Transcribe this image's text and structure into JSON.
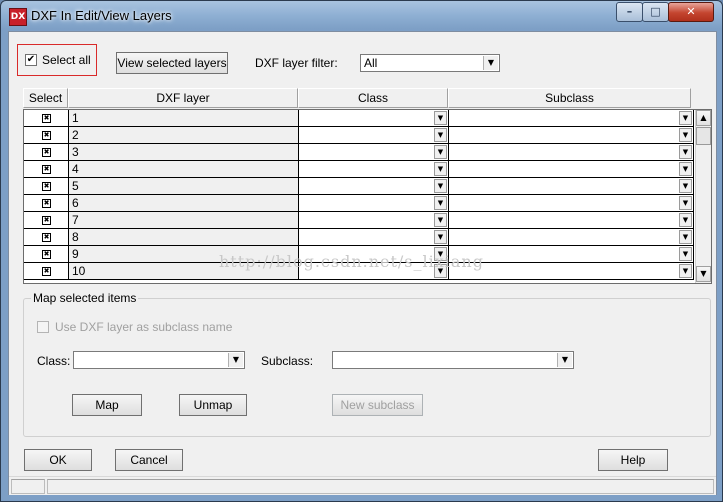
{
  "window": {
    "title": "DXF In Edit/View Layers",
    "app_icon_text": "DX",
    "minimize_symbol": "–",
    "maximize_symbol": "□",
    "close_symbol": "✕"
  },
  "toolbar": {
    "select_all_label": "Select all",
    "select_all_checked": true,
    "view_selected_label": "View selected layers",
    "filter_label": "DXF layer filter:",
    "filter_value": "All"
  },
  "grid": {
    "columns": [
      "Select",
      "DXF layer",
      "Class",
      "Subclass"
    ],
    "rows": [
      {
        "layer": "1",
        "selected": true
      },
      {
        "layer": "2",
        "selected": true
      },
      {
        "layer": "3",
        "selected": true
      },
      {
        "layer": "4",
        "selected": true
      },
      {
        "layer": "5",
        "selected": true
      },
      {
        "layer": "6",
        "selected": true
      },
      {
        "layer": "7",
        "selected": true
      },
      {
        "layer": "8",
        "selected": true
      },
      {
        "layer": "9",
        "selected": true
      },
      {
        "layer": "10",
        "selected": true
      }
    ],
    "checked_symbol": "✖",
    "dropdown_symbol": "▼",
    "scroll_up_symbol": "▲",
    "scroll_down_symbol": "▼"
  },
  "watermark": "http://blog.csdn.net/s_lixiang",
  "map_group": {
    "title": "Map selected items",
    "use_layer_label": "Use DXF layer as subclass name",
    "class_label": "Class:",
    "class_value": "",
    "subclass_label": "Subclass:",
    "subclass_value": "",
    "map_label": "Map",
    "unmap_label": "Unmap",
    "new_subclass_label": "New subclass"
  },
  "footer": {
    "ok_label": "OK",
    "cancel_label": "Cancel",
    "help_label": "Help"
  },
  "colors": {
    "title_gradient_top": "#a9c3df",
    "highlight_box": "#d92a2a",
    "client_bg": "#f0f0f0"
  }
}
